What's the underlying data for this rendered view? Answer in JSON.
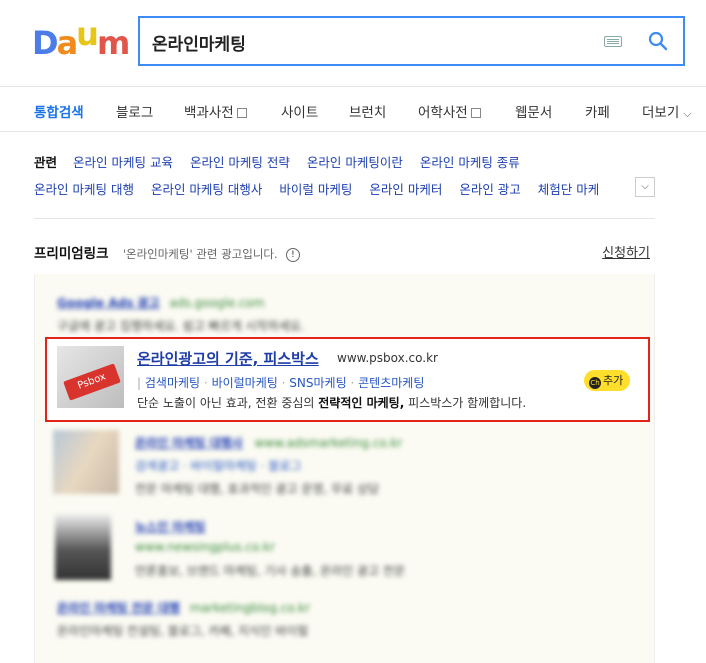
{
  "logo": {
    "text": "Daum",
    "letters": [
      "D",
      "a",
      "u",
      "m"
    ],
    "colors": [
      "#4b7ce8",
      "#f28b1e",
      "#e8c617",
      "#e0564a"
    ]
  },
  "search": {
    "query": "온라인마케팅",
    "keyboard_icon": "keyboard-icon",
    "search_icon": "search-icon"
  },
  "tabs": [
    {
      "label": "통합검색"
    },
    {
      "label": "블로그"
    },
    {
      "label": "백과사전"
    },
    {
      "label": "사이트"
    },
    {
      "label": "브런치"
    },
    {
      "label": "어학사전"
    },
    {
      "label": "웹문서"
    },
    {
      "label": "카페"
    },
    {
      "label": "더보기"
    }
  ],
  "related": {
    "title": "관련",
    "row1": [
      "온라인 마케팅 교육",
      "온라인 마케팅 전략",
      "온라인 마케팅이란",
      "온라인 마케팅 종류"
    ],
    "row2": [
      "온라인 마케팅 대행",
      "온라인 마케팅 대행사",
      "바이럴 마케팅",
      "온라인 마케터",
      "온라인 광고",
      "체험단 마케"
    ]
  },
  "premium": {
    "title": "프리미엄링크",
    "desc": "'온라인마케팅' 관련 광고입니다.",
    "info": "!",
    "apply": "신청하기"
  },
  "highlight_ad": {
    "title": "온라인광고의 기준, 피스박스",
    "url": "www.psbox.co.kr",
    "tags": [
      "검색마케팅",
      "바이럴마케팅",
      "SNS마케팅",
      "콘텐츠마케팅"
    ],
    "desc_before": "단순 노출이 아닌 효과, 전환 중심의 ",
    "desc_bold": "전략적인 마케팅,",
    "desc_after": " 피스박스가 함께합니다.",
    "thumb_key": "Psbox",
    "badge": "추가",
    "badge_icon": "Ch"
  },
  "blurred_ads": {
    "ad1_title": "Google Ads 광고",
    "ad1_url": "ads.google.com",
    "ad1_desc": "구글에 광고 집행하세요. 쉽고 빠르게 시작하세요.",
    "ad2_title": "온라인 마케팅 대행사",
    "ad2_url": "www.adsmarketing.co.kr",
    "ad2_tags": "검색광고 · 바이럴마케팅 · 블로그",
    "ad2_desc": "전문 마케팅 대행, 효과적인 광고 운영, 무료 상담",
    "ad3_title": "뉴스인 마케팅",
    "ad3_url": "www.newsingplus.co.kr",
    "ad3_desc": "언론홍보, 브랜드 마케팅, 기사 송출, 온라인 광고 전문",
    "ad4_title": "온라인 마케팅 전문 대행",
    "ad4_url": "marketingblog.co.kr",
    "ad4_desc": "온라인마케팅 컨설팅, 블로그, 카페, 지식인 바이럴"
  }
}
